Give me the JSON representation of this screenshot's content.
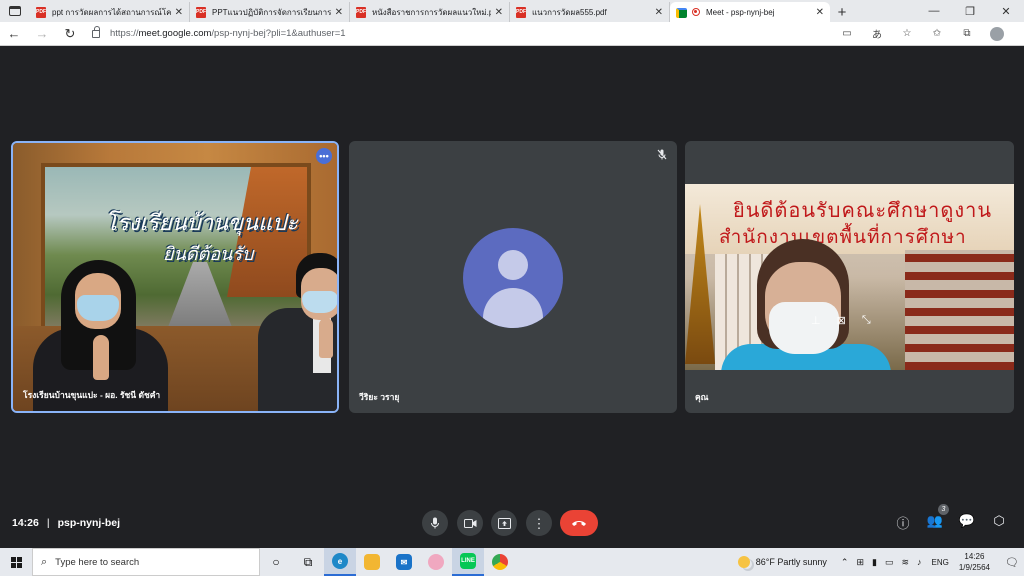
{
  "browser": {
    "tabs": [
      {
        "title": "ppt การวัดผลการได้สถานการณ์โควิด",
        "type": "pdf"
      },
      {
        "title": "PPTแนวปฏิบัติการจัดการเรียนการสอน",
        "type": "pdf"
      },
      {
        "title": "หนังสือราชการการวัดผลแนวใหม่.pdf",
        "type": "pdf"
      },
      {
        "title": "แนวการวัดผล555.pdf",
        "type": "pdf"
      },
      {
        "title": "Meet - psp-nynj-bej",
        "type": "meet"
      }
    ],
    "url_prefix": "https://",
    "url_host": "meet.google.com",
    "url_path": "/psp-nynj-bej?pli=1&authuser=1"
  },
  "meeting": {
    "time": "14:26",
    "code": "psp-nynj-bej",
    "participant_count": "3",
    "tiles": [
      {
        "name": "โรงเรียนบ้านขุนแปะ - ผอ. รัชนี ดัชคำ",
        "sign_line1": "โรงเรียนบ้านขุนแปะ",
        "sign_line2": "ยินดีต้อนรับ"
      },
      {
        "name": "วีริยะ วรายุ"
      },
      {
        "name": "คุณ",
        "banner_line1": "ยินดีต้อนรับคณะศึกษาดูงาน",
        "banner_line2": "สำนักงานเขตพื้นที่การศึกษา"
      }
    ]
  },
  "taskbar": {
    "search_placeholder": "Type here to search",
    "weather": "86°F  Partly sunny",
    "lang": "ENG",
    "clock_time": "14:26",
    "clock_date": "1/9/2564"
  },
  "colors": {
    "meet_bg": "#202124",
    "tile_bg": "#3c4043",
    "avatar": "#5c6bc0",
    "end_call": "#ea4335",
    "active_tile_border": "#8ab4f8"
  }
}
